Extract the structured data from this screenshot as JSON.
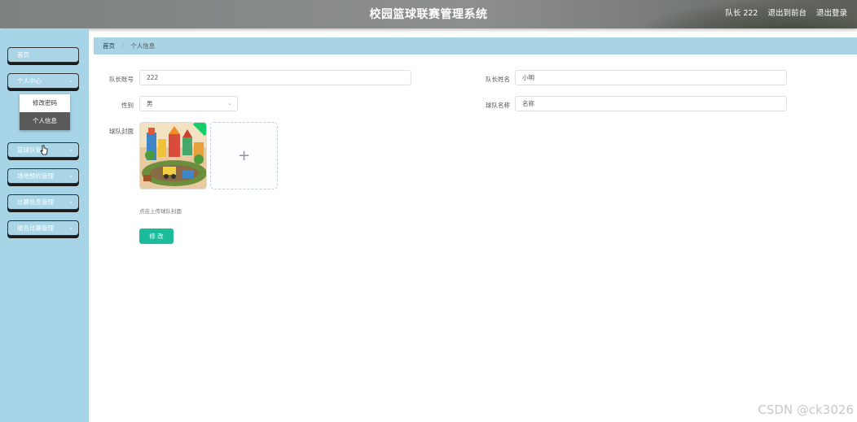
{
  "header": {
    "title": "校园篮球联赛管理系统",
    "user_label": "队长 222",
    "back_to_front": "退出到前台",
    "logout": "退出登录"
  },
  "sidebar": {
    "items": [
      {
        "label": "首页"
      },
      {
        "label": "个人中心"
      },
      {
        "label": "篮球队管理"
      },
      {
        "label": "场地预约管理"
      },
      {
        "label": "比赛信息管理"
      },
      {
        "label": "报名比赛管理"
      }
    ],
    "submenu": [
      {
        "label": "修改密码"
      },
      {
        "label": "个人信息"
      }
    ]
  },
  "breadcrumb": {
    "home": "首页",
    "current": "个人信息"
  },
  "form": {
    "captain_account_label": "队长账号",
    "captain_account_value": "222",
    "captain_name_label": "队长姓名",
    "captain_name_value": "小明",
    "gender_label": "性别",
    "gender_value": "男",
    "team_name_label": "球队名称",
    "team_name_value": "名称",
    "cover_label": "球队封面",
    "upload_hint": "点击上传球队封面",
    "submit_label": "修 改"
  },
  "watermark": "CSDN @ck3026",
  "colors": {
    "sidebar_bg": "#a7d4e6",
    "breadcrumb_bg": "#a9d4e5",
    "submit_button": "#1abc9c",
    "active_submenu": "#5a5a5a"
  }
}
